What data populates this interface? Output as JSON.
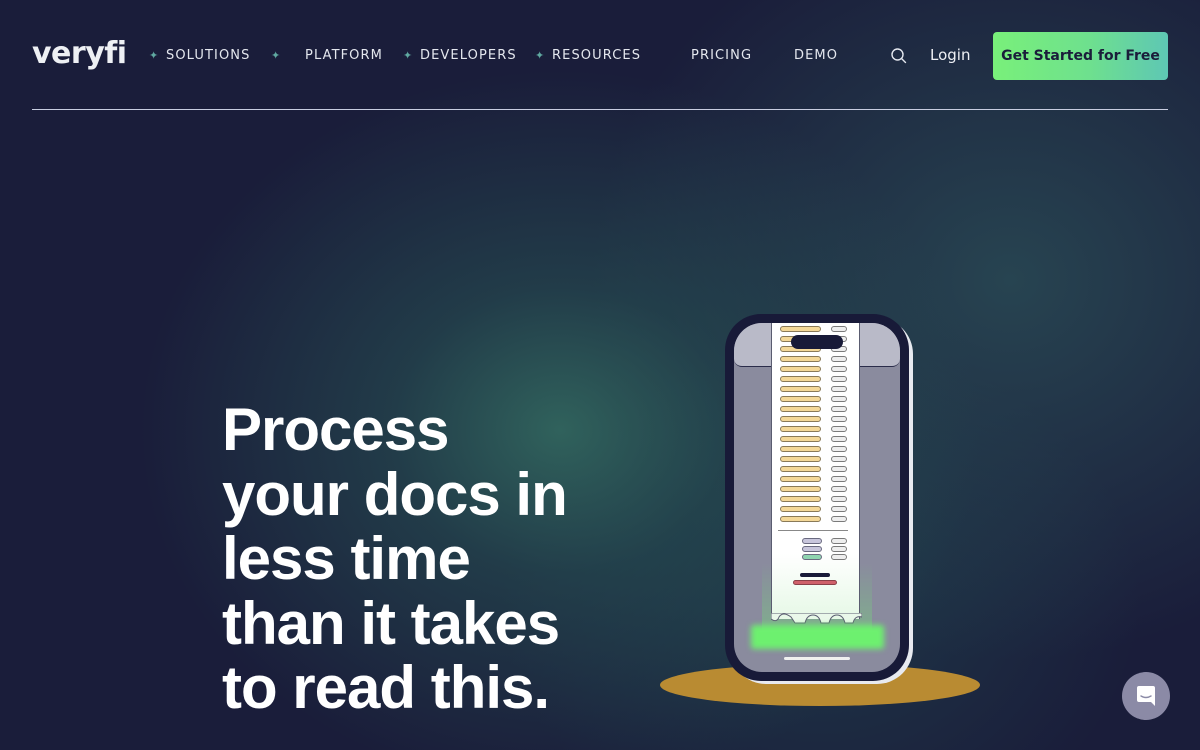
{
  "brand": {
    "logo_text": "veryfi"
  },
  "nav": {
    "items": [
      {
        "label": "SOLUTIONS",
        "has_spark": true
      },
      {
        "label": "PLATFORM",
        "has_spark": true
      },
      {
        "label": "DEVELOPERS",
        "has_spark": true
      },
      {
        "label": "RESOURCES",
        "has_spark": true
      },
      {
        "label": "PRICING",
        "has_spark": false
      },
      {
        "label": "DEMO",
        "has_spark": false
      }
    ],
    "spark_icon": "sparkle-icon",
    "search_icon": "search-icon",
    "login_label": "Login",
    "cta_label": "Get Started for Free"
  },
  "hero": {
    "title_lines": [
      "Process",
      "your docs in",
      "less time",
      "than it takes",
      "to read this."
    ]
  },
  "illustration": {
    "description": "phone scanning a receipt on a gold pedestal",
    "colors": {
      "pedestal": "#b98b32",
      "scan_glow": "#6df06f",
      "receipt_item": "#f4d898",
      "total_bar": "#d0606a"
    }
  },
  "chat": {
    "icon": "chat-icon"
  },
  "colors": {
    "background": "#1a1d3a",
    "accent_green": "#79f07a",
    "accent_teal": "#5ec7b4",
    "spark": "#5fa8a0"
  }
}
